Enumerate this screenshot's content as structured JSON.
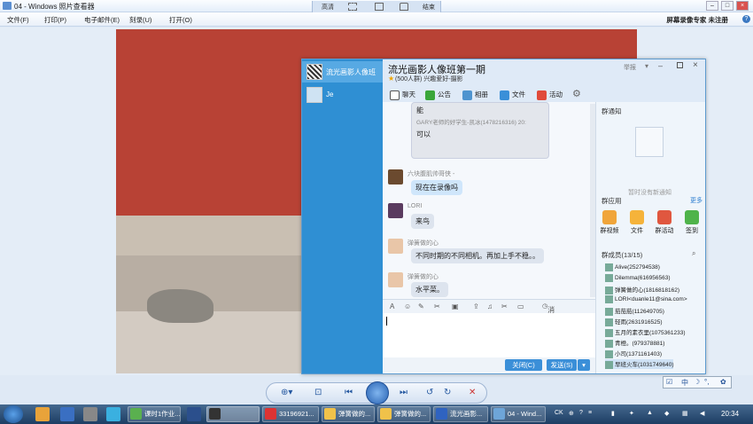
{
  "window": {
    "title": "04 - Windows 照片查看器",
    "top_tabs": [
      "高清",
      "结束"
    ]
  },
  "menu": {
    "items": [
      "文件(F)",
      "打印(P)",
      "电子邮件(E)",
      "刻录(U)",
      "打开(O)"
    ],
    "promo": "屏幕录像专家 未注册"
  },
  "chat": {
    "sessions": [
      {
        "name": "流光画影人像班"
      },
      {
        "name": "Je"
      }
    ],
    "group_name": "流光画影人像班第一期",
    "group_info": "(500人群) 兴趣爱好-摄影",
    "header_action": "举报",
    "tabs": [
      "聊天",
      "公告",
      "相册",
      "文件",
      "活动"
    ],
    "messages": [
      {
        "nick": "",
        "text": "能"
      },
      {
        "nick": "",
        "text": "GARY老师的好学生-凯冰(1478216316) 20:"
      },
      {
        "nick": "",
        "text": "可以"
      },
      {
        "nick": "六块腹肌帅哥侠 -",
        "text": "现在在录像吗"
      },
      {
        "nick": "LORI",
        "text": "来鸟"
      },
      {
        "nick": "弹簧做的心",
        "text": "不同时期的不同相机。再加上手不稳。。"
      },
      {
        "nick": "弹簧做的心",
        "text": "水平菜。"
      }
    ],
    "history_label": "消息记录",
    "close_label": "关闭(C)",
    "send_label": "发送(S)",
    "notice_title": "群通知",
    "notice_empty": "暂时没有新通知",
    "apps_title": "群应用",
    "apps_more": "更多",
    "apps": [
      "群视频",
      "文件",
      "群活动",
      "签到"
    ],
    "members_title": "群成员(13/15)",
    "members": [
      "Alive(252794538)",
      "Dilemma(616956563)",
      "弹簧做的心(1816818162)",
      "LORI<duanle11@sina.com>",
      "茄茄茄(112649705)",
      "轻雨(2631916525)",
      "五月的素衣里(1075361233)",
      "青橙。(979378881)",
      "小司(1371161403)",
      "早班火车(1031749640)"
    ]
  },
  "taskbar": {
    "buttons": [
      "课时1作业...",
      "",
      "33196921...",
      "弹簧做的...",
      "弹簧做的...",
      "流光画影...",
      "04 - Wind..."
    ],
    "clock": "20:34",
    "tray_text": "CK"
  }
}
